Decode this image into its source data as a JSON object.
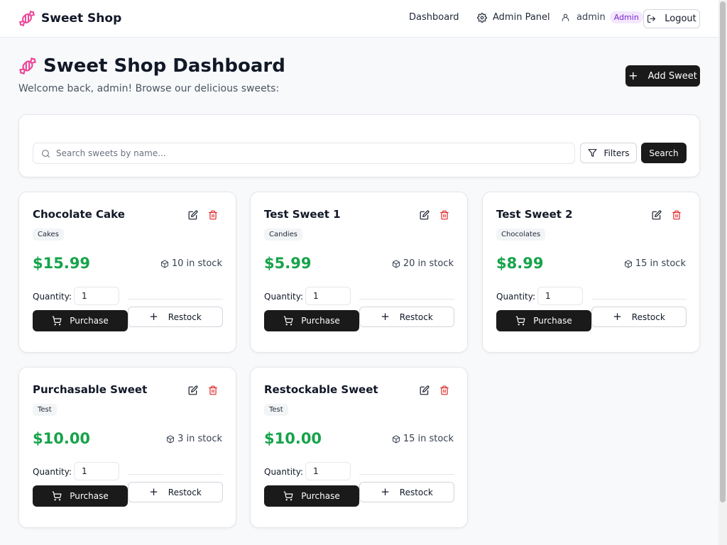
{
  "header": {
    "brand": "Sweet Shop",
    "nav": {
      "dashboard": "Dashboard",
      "admin_panel": "Admin Panel"
    },
    "user": {
      "name": "admin",
      "role": "Admin"
    },
    "logout": "Logout"
  },
  "page": {
    "title": "Sweet Shop Dashboard",
    "subtitle": "Welcome back, admin! Browse our delicious sweets:",
    "add_button": "Add Sweet"
  },
  "search": {
    "placeholder": "Search sweets by name...",
    "value": "",
    "filters_label": "Filters",
    "search_label": "Search"
  },
  "card_labels": {
    "quantity": "Quantity:",
    "purchase": "Purchase",
    "restock": "Restock"
  },
  "sweets": [
    {
      "name": "Chocolate Cake",
      "category": "Cakes",
      "price": "$15.99",
      "stock": "10 in stock",
      "quantity": "1"
    },
    {
      "name": "Test Sweet 1",
      "category": "Candies",
      "price": "$5.99",
      "stock": "20 in stock",
      "quantity": "1"
    },
    {
      "name": "Test Sweet 2",
      "category": "Chocolates",
      "price": "$8.99",
      "stock": "15 in stock",
      "quantity": "1"
    },
    {
      "name": "Purchasable Sweet",
      "category": "Test",
      "price": "$10.00",
      "stock": "3 in stock",
      "quantity": "1"
    },
    {
      "name": "Restockable Sweet",
      "category": "Test",
      "price": "$10.00",
      "stock": "15 in stock",
      "quantity": "1"
    }
  ],
  "colors": {
    "brand_pink": "#ec4899",
    "price_green": "#16a34a",
    "primary_dark": "#1a1a1a",
    "delete_red": "#dc2626",
    "role_badge_bg": "#f3e8ff",
    "role_badge_text": "#7e22ce"
  },
  "icons": {
    "brand": "candy-icon",
    "admin_panel": "gear-icon",
    "user": "user-icon",
    "logout": "logout-icon",
    "search": "search-icon",
    "filters": "filter-icon",
    "edit": "edit-icon",
    "delete": "trash-icon",
    "stock": "package-icon",
    "purchase": "cart-icon",
    "restock": "plus-icon",
    "add": "plus-icon"
  }
}
